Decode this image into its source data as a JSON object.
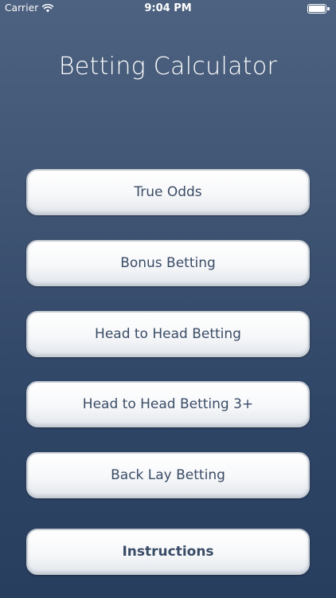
{
  "status_bar": {
    "carrier": "Carrier",
    "time": "9:04 PM",
    "icons": [
      "wifi-icon",
      "battery-icon"
    ]
  },
  "app": {
    "title": "Betting Calculator"
  },
  "menu": {
    "items": [
      {
        "label": "True Odds"
      },
      {
        "label": "Bonus Betting"
      },
      {
        "label": "Head to Head Betting"
      },
      {
        "label": "Head to Head Betting 3+"
      },
      {
        "label": "Back Lay Betting"
      },
      {
        "label": "Instructions"
      }
    ]
  },
  "colors": {
    "background_top": "#4d6280",
    "background_bottom": "#283e5e",
    "button_text": "#3a4c66",
    "title_text": "#ffffff"
  }
}
